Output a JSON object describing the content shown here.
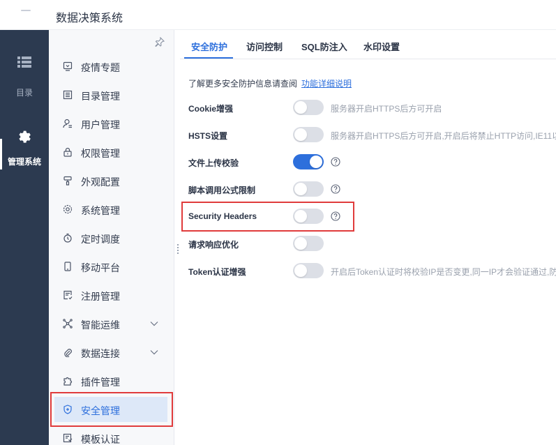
{
  "header": {
    "title": "数据决策系统"
  },
  "rail": {
    "items": [
      {
        "label": "目录",
        "icon": "list-icon"
      },
      {
        "label": "管理系统",
        "icon": "gear-icon"
      }
    ]
  },
  "menu": {
    "items": [
      {
        "label": "疫情专题",
        "icon": "screen-icon"
      },
      {
        "label": "目录管理",
        "icon": "catalog-icon"
      },
      {
        "label": "用户管理",
        "icon": "user-icon"
      },
      {
        "label": "权限管理",
        "icon": "lock-icon"
      },
      {
        "label": "外观配置",
        "icon": "brush-icon"
      },
      {
        "label": "系统管理",
        "icon": "settings-icon"
      },
      {
        "label": "定时调度",
        "icon": "timer-icon"
      },
      {
        "label": "移动平台",
        "icon": "mobile-icon"
      },
      {
        "label": "注册管理",
        "icon": "register-icon"
      },
      {
        "label": "智能运维",
        "icon": "network-icon"
      },
      {
        "label": "数据连接",
        "icon": "paperclip-icon"
      },
      {
        "label": "插件管理",
        "icon": "puzzle-icon"
      },
      {
        "label": "安全管理",
        "icon": "shield-icon"
      },
      {
        "label": "模板认证",
        "icon": "template-icon"
      }
    ],
    "active_index": 12
  },
  "tabs": [
    {
      "label": "安全防护"
    },
    {
      "label": "访问控制"
    },
    {
      "label": "SQL防注入"
    },
    {
      "label": "水印设置"
    }
  ],
  "content": {
    "info_text": "了解更多安全防护信息请查阅",
    "info_link": "功能详细说明",
    "settings": [
      {
        "label": "Cookie增强",
        "enabled": false,
        "description": "服务器开启HTTPS后方可开启"
      },
      {
        "label": "HSTS设置",
        "enabled": false,
        "description": "服务器开启HTTPS后方可开启,开启后将禁止HTTP访问,IE11以"
      },
      {
        "label": "文件上传校验",
        "enabled": true
      },
      {
        "label": "脚本调用公式限制",
        "enabled": false
      },
      {
        "label": "Security Headers",
        "enabled": false
      },
      {
        "label": "请求响应优化",
        "enabled": false
      },
      {
        "label": "Token认证增强",
        "enabled": false,
        "description": "开启后Token认证时将校验IP是否变更,同一IP才会验证通过,防"
      }
    ]
  },
  "colors": {
    "accent": "#2d6fdc",
    "rail_bg": "#2c3a50",
    "highlight": "#e03b3b"
  }
}
